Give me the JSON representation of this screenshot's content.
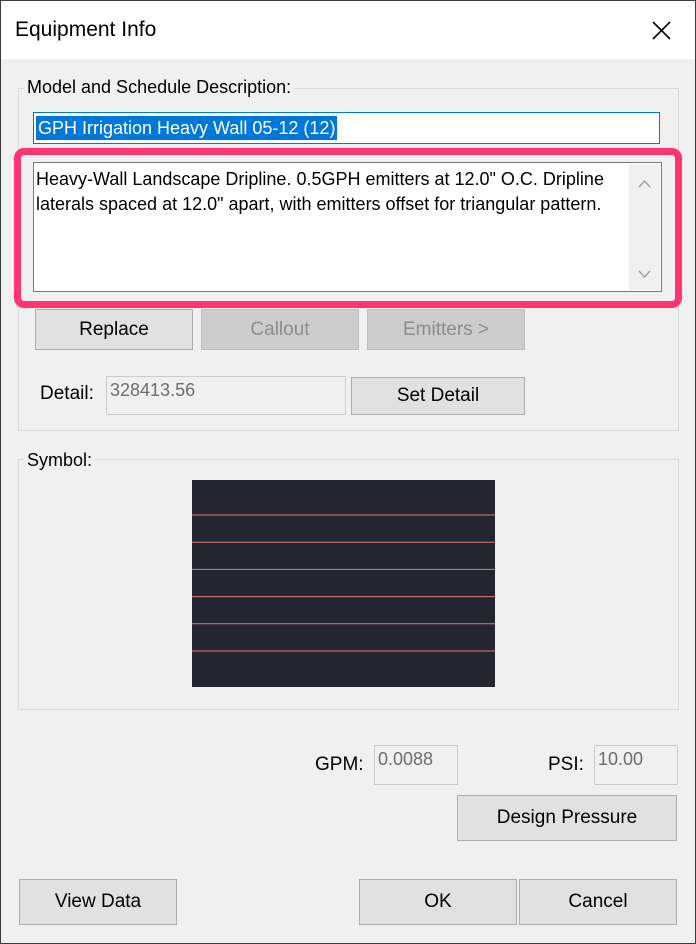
{
  "window": {
    "title": "Equipment Info",
    "close_icon": "close-icon"
  },
  "model_group": {
    "label": "Model and Schedule Description:",
    "model_value": "GPH Irrigation Heavy Wall 05-12 (12)",
    "description": "Heavy-Wall Landscape Dripline. 0.5GPH emitters at 12.0\" O.C. Dripline laterals spaced at 12.0\" apart, with emitters offset for triangular pattern.",
    "scroll_up_icon": "chevron-up-icon",
    "scroll_down_icon": "chevron-down-icon",
    "highlight_color": "#ff3470"
  },
  "buttons": {
    "replace": "Replace",
    "callout": "Callout",
    "emitters": "Emitters >",
    "set_detail": "Set Detail",
    "design_pressure": "Design Pressure",
    "view_data": "View Data",
    "ok": "OK",
    "cancel": "Cancel"
  },
  "detail": {
    "label": "Detail:",
    "value": "328413.56"
  },
  "symbol": {
    "label": "Symbol:",
    "background_color": "#23262f",
    "line_color": "#e07a7a",
    "line_count": 6
  },
  "flow": {
    "gpm_label": "GPM:",
    "gpm_value": "0.0088",
    "psi_label": "PSI:",
    "psi_value": "10.00"
  }
}
